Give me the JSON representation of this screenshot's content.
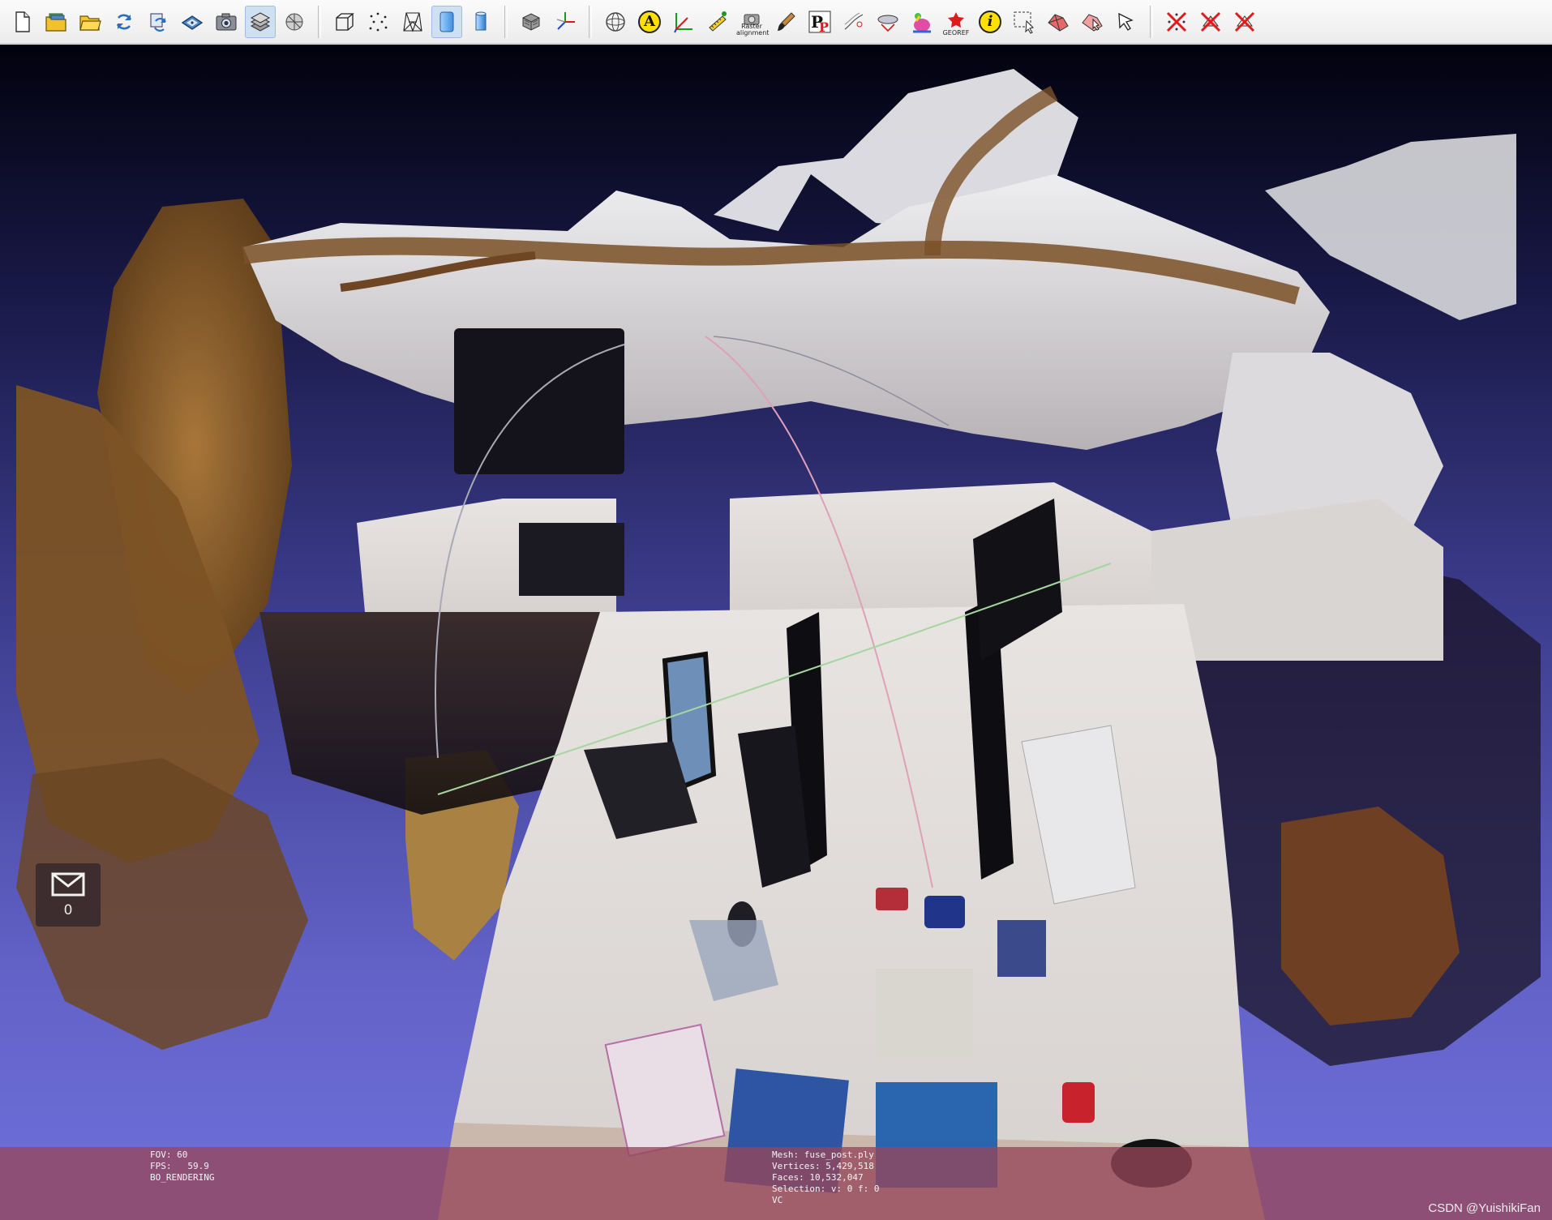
{
  "toolbar": {
    "buttons": [
      {
        "name": "new-project",
        "icon": "new-document-icon"
      },
      {
        "name": "open-project",
        "icon": "open-layers-icon"
      },
      {
        "name": "import-mesh",
        "icon": "folder-open-icon"
      },
      {
        "name": "reload",
        "icon": "reload-icon"
      },
      {
        "name": "reload-all",
        "icon": "reload-all-icon"
      },
      {
        "name": "save",
        "icon": "save-disk-icon"
      },
      {
        "name": "snapshot",
        "icon": "camera-icon"
      },
      {
        "name": "layers",
        "icon": "layers-icon",
        "active": true
      },
      {
        "name": "raster-layers",
        "icon": "raster-icon"
      },
      {
        "name": "bounding-box",
        "icon": "box-icon"
      },
      {
        "name": "points",
        "icon": "points-icon"
      },
      {
        "name": "wireframe",
        "icon": "wireframe-icon"
      },
      {
        "name": "flat",
        "icon": "flat-icon",
        "active": true
      },
      {
        "name": "smooth",
        "icon": "smooth-icon"
      },
      {
        "name": "texture",
        "icon": "texture-icon"
      },
      {
        "name": "axes",
        "icon": "axes-icon"
      },
      {
        "name": "trackball",
        "icon": "trackball-icon"
      },
      {
        "name": "annotate",
        "icon": "annotation-icon",
        "label": "A"
      },
      {
        "name": "measure",
        "icon": "measure-icon"
      },
      {
        "name": "pick-points",
        "icon": "pick-points-icon"
      },
      {
        "name": "raster-alignment",
        "icon": "alignment-camera-icon",
        "label": "Raster alignment"
      },
      {
        "name": "paint",
        "icon": "paint-brush-icon"
      },
      {
        "name": "pick-points-p",
        "icon": "pp-icon"
      },
      {
        "name": "align-points",
        "icon": "align-icon"
      },
      {
        "name": "manipulators",
        "icon": "manipulator-icon"
      },
      {
        "name": "color-paint",
        "icon": "bunny-color-icon"
      },
      {
        "name": "georef",
        "icon": "georef-icon",
        "label": "GEOREF"
      },
      {
        "name": "info",
        "icon": "info-icon",
        "label": "i"
      },
      {
        "name": "select-vertices",
        "icon": "select-vertices-icon"
      },
      {
        "name": "select-faces",
        "icon": "select-faces-icon"
      },
      {
        "name": "select-connected",
        "icon": "select-connected-icon"
      },
      {
        "name": "select-pointer",
        "icon": "select-pointer-icon"
      },
      {
        "name": "delete-vertices",
        "icon": "delete-vertices-icon"
      },
      {
        "name": "delete-faces",
        "icon": "delete-faces-icon"
      },
      {
        "name": "delete-faces-vertices",
        "icon": "delete-faces-vertices-icon"
      }
    ]
  },
  "notification": {
    "count": "0",
    "icon": "envelope-icon"
  },
  "info_left": {
    "fov": "FOV: 60",
    "fps": "FPS:   59.9",
    "mode": "BO_RENDERING"
  },
  "info_right": {
    "mesh": "Mesh: fuse_post.ply",
    "vertices": "Vertices: 5,429,518",
    "faces": "Faces: 10,532,047",
    "selection": "Selection: v: 0 f: 0",
    "vc": "VC"
  },
  "watermark": "CSDN @YuishikiFan",
  "colors": {
    "toolbar_bg": "#eeeeee",
    "active_button": "#cfe0f3",
    "bg_top": "#02020e",
    "bg_bottom": "#7070dc",
    "info_band": "#964658"
  }
}
